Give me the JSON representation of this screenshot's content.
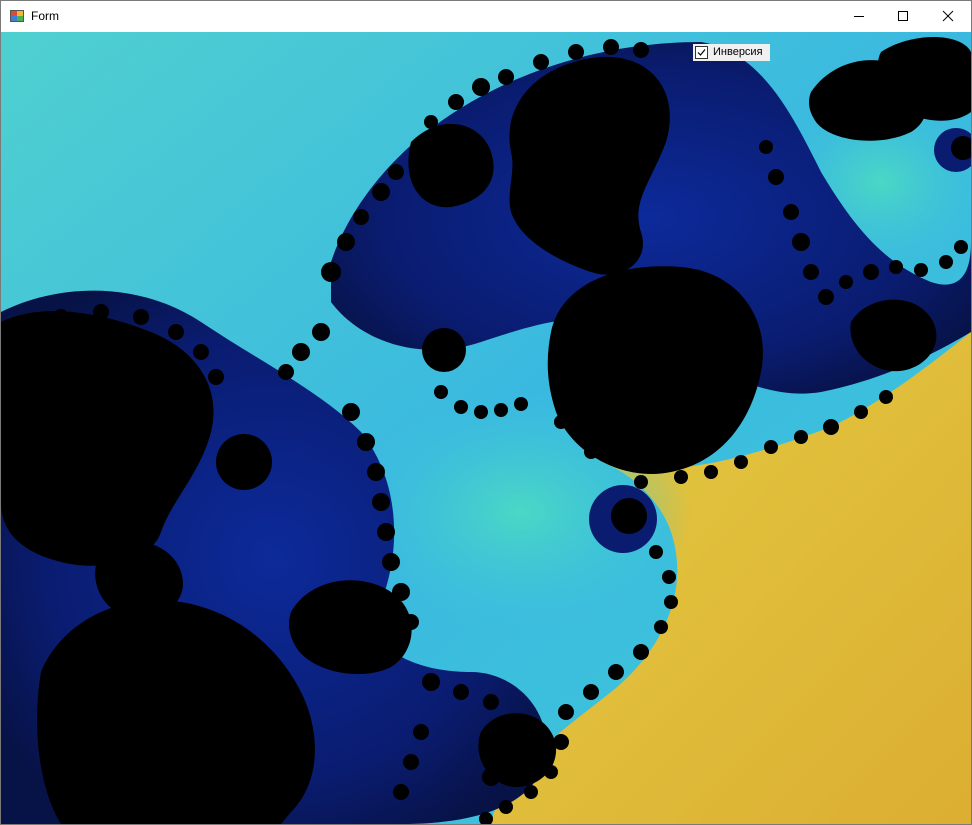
{
  "window": {
    "title": "Form",
    "icon": "windows-form-icon",
    "controls": {
      "minimize_icon": "minimize-icon",
      "maximize_icon": "maximize-icon",
      "close_icon": "close-icon"
    }
  },
  "inversion_checkbox": {
    "label": "Инверсия",
    "checked": true
  },
  "fractal": {
    "colors": {
      "cyan": "#45c8d4",
      "light_teal": "#4ad4c8",
      "deep_blue": "#0a1a6e",
      "navy": "#081550",
      "black": "#000000",
      "gold": "#ddb93a",
      "yellow": "#e0c840"
    }
  }
}
